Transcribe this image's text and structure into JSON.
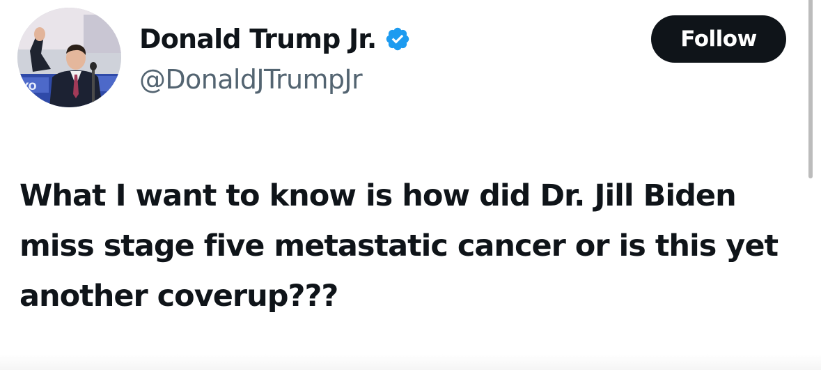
{
  "tweet": {
    "author": {
      "display_name": "Donald Trump Jr.",
      "handle": "@DonaldJTrumpJr",
      "verified": true,
      "verified_icon": "verified-badge-icon"
    },
    "follow_label": "Follow",
    "text": "What I want to know is how did Dr. Jill Biden miss stage five metastatic cancer or is this yet another coverup???"
  },
  "colors": {
    "text_primary": "#0f1419",
    "text_secondary": "#536471",
    "verified_blue": "#1d9bf0",
    "button_background": "#0f1419",
    "button_text": "#ffffff",
    "background": "#ffffff"
  }
}
